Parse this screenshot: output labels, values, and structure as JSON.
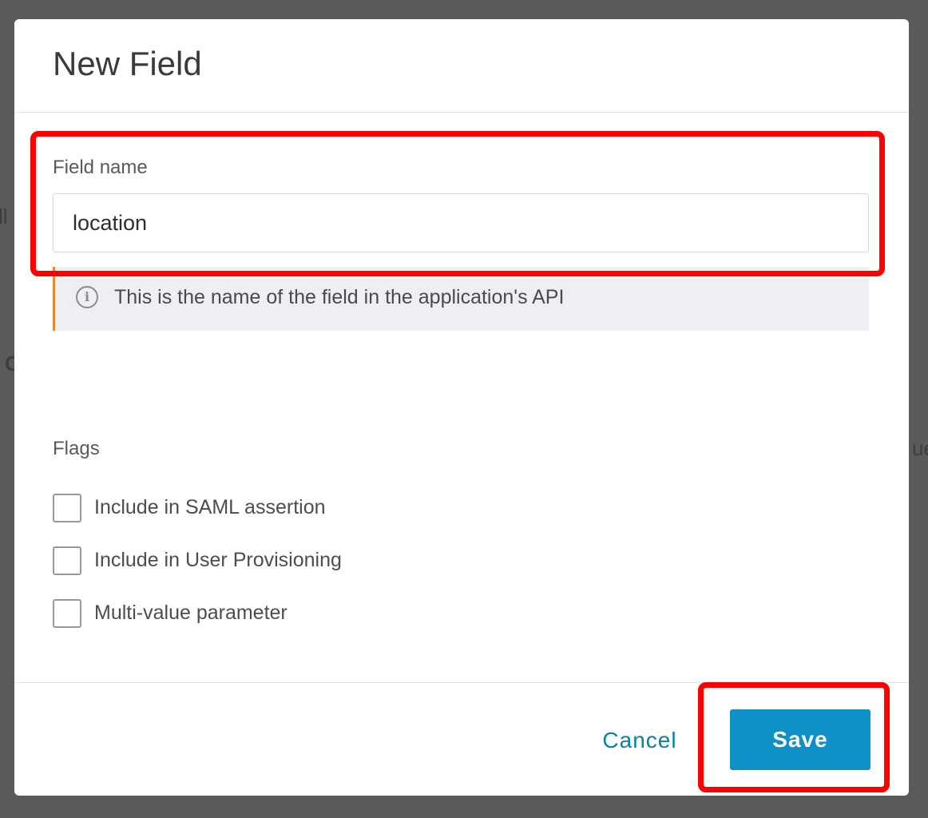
{
  "background": {
    "fragment_left_top": "ll",
    "fragment_left_mid": "C",
    "fragment_right": "ue"
  },
  "dialog": {
    "title": "New Field",
    "field_name": {
      "label": "Field name",
      "value": "location"
    },
    "help": {
      "icon": "info-icon",
      "text": "This is the name of the field in the application's API"
    },
    "flags": {
      "label": "Flags",
      "options": [
        {
          "label": "Include in SAML assertion",
          "checked": false
        },
        {
          "label": "Include in User Provisioning",
          "checked": false
        },
        {
          "label": "Multi-value parameter",
          "checked": false
        }
      ]
    },
    "footer": {
      "cancel_label": "Cancel",
      "save_label": "Save"
    }
  },
  "colors": {
    "primary": "#0e91c7",
    "link": "#0a7fa9",
    "help_accent": "#e5892f",
    "highlight": "#ff0000"
  }
}
